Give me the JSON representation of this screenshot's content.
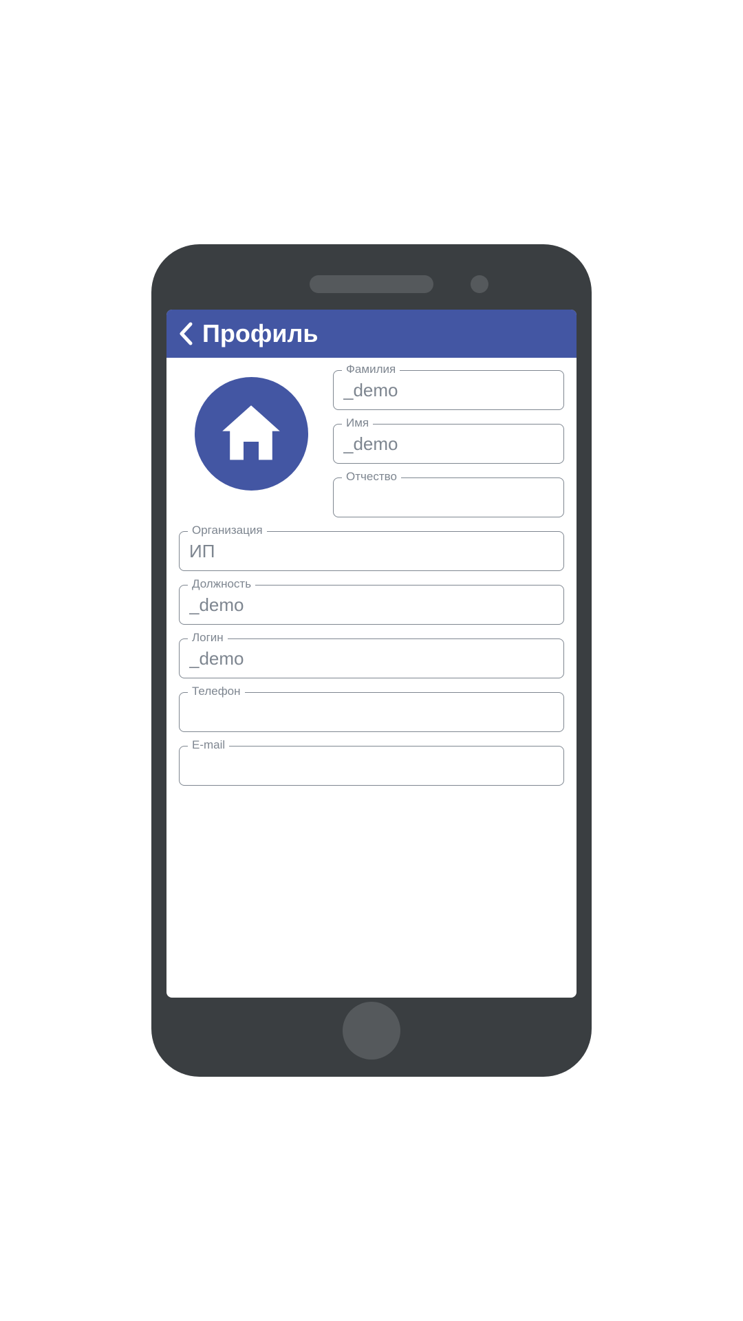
{
  "header": {
    "title": "Профиль"
  },
  "profile": {
    "fields": {
      "lastname": {
        "label": "Фамилия",
        "value": "_demo"
      },
      "firstname": {
        "label": "Имя",
        "value": "_demo"
      },
      "patronymic": {
        "label": "Отчество",
        "value": ""
      },
      "organization": {
        "label": "Организация",
        "value": "ИП"
      },
      "position": {
        "label": "Должность",
        "value": "_demo"
      },
      "login": {
        "label": "Логин",
        "value": "_demo"
      },
      "phone": {
        "label": "Телефон",
        "value": ""
      },
      "email": {
        "label": "E-mail",
        "value": ""
      }
    }
  },
  "colors": {
    "accent": "#4356a3",
    "border": "#7e8690",
    "text_muted": "#7e8690"
  }
}
